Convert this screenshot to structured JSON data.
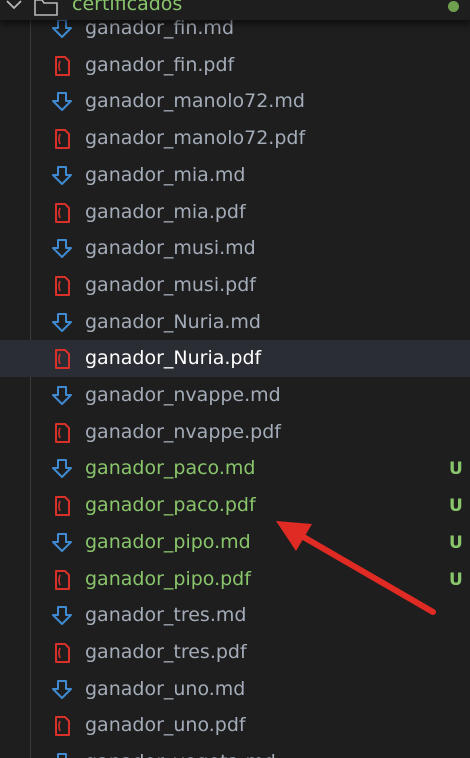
{
  "folder": {
    "label": "certificados",
    "chevron_icon": "chevron-down-icon",
    "folder_icon": "folder-icon",
    "status_color": "#6fa050"
  },
  "colors": {
    "background": "#1e1e1e",
    "text": "#a3acb8",
    "selected_text": "#ffffff",
    "untracked_text": "#89c56b",
    "md_icon": "#3f8ad0",
    "pdf_icon": "#d9302a",
    "arrow": "#e02a24"
  },
  "files": [
    {
      "name": "ganador_fin.md",
      "type": "md",
      "status": "",
      "selected": false
    },
    {
      "name": "ganador_fin.pdf",
      "type": "pdf",
      "status": "",
      "selected": false
    },
    {
      "name": "ganador_manolo72.md",
      "type": "md",
      "status": "",
      "selected": false
    },
    {
      "name": "ganador_manolo72.pdf",
      "type": "pdf",
      "status": "",
      "selected": false
    },
    {
      "name": "ganador_mia.md",
      "type": "md",
      "status": "",
      "selected": false
    },
    {
      "name": "ganador_mia.pdf",
      "type": "pdf",
      "status": "",
      "selected": false
    },
    {
      "name": "ganador_musi.md",
      "type": "md",
      "status": "",
      "selected": false
    },
    {
      "name": "ganador_musi.pdf",
      "type": "pdf",
      "status": "",
      "selected": false
    },
    {
      "name": "ganador_Nuria.md",
      "type": "md",
      "status": "",
      "selected": false
    },
    {
      "name": "ganador_Nuria.pdf",
      "type": "pdf",
      "status": "",
      "selected": true
    },
    {
      "name": "ganador_nvappe.md",
      "type": "md",
      "status": "",
      "selected": false
    },
    {
      "name": "ganador_nvappe.pdf",
      "type": "pdf",
      "status": "",
      "selected": false
    },
    {
      "name": "ganador_paco.md",
      "type": "md",
      "status": "U",
      "selected": false
    },
    {
      "name": "ganador_paco.pdf",
      "type": "pdf",
      "status": "U",
      "selected": false
    },
    {
      "name": "ganador_pipo.md",
      "type": "md",
      "status": "U",
      "selected": false
    },
    {
      "name": "ganador_pipo.pdf",
      "type": "pdf",
      "status": "U",
      "selected": false
    },
    {
      "name": "ganador_tres.md",
      "type": "md",
      "status": "",
      "selected": false
    },
    {
      "name": "ganador_tres.pdf",
      "type": "pdf",
      "status": "",
      "selected": false
    },
    {
      "name": "ganador_uno.md",
      "type": "md",
      "status": "",
      "selected": false
    },
    {
      "name": "ganador_uno.pdf",
      "type": "pdf",
      "status": "",
      "selected": false
    },
    {
      "name": "ganador_vegeta.md",
      "type": "md",
      "status": "",
      "selected": false
    }
  ],
  "annotation": {
    "icon": "red-arrow-icon",
    "points_to": "ganador_paco.pdf"
  }
}
